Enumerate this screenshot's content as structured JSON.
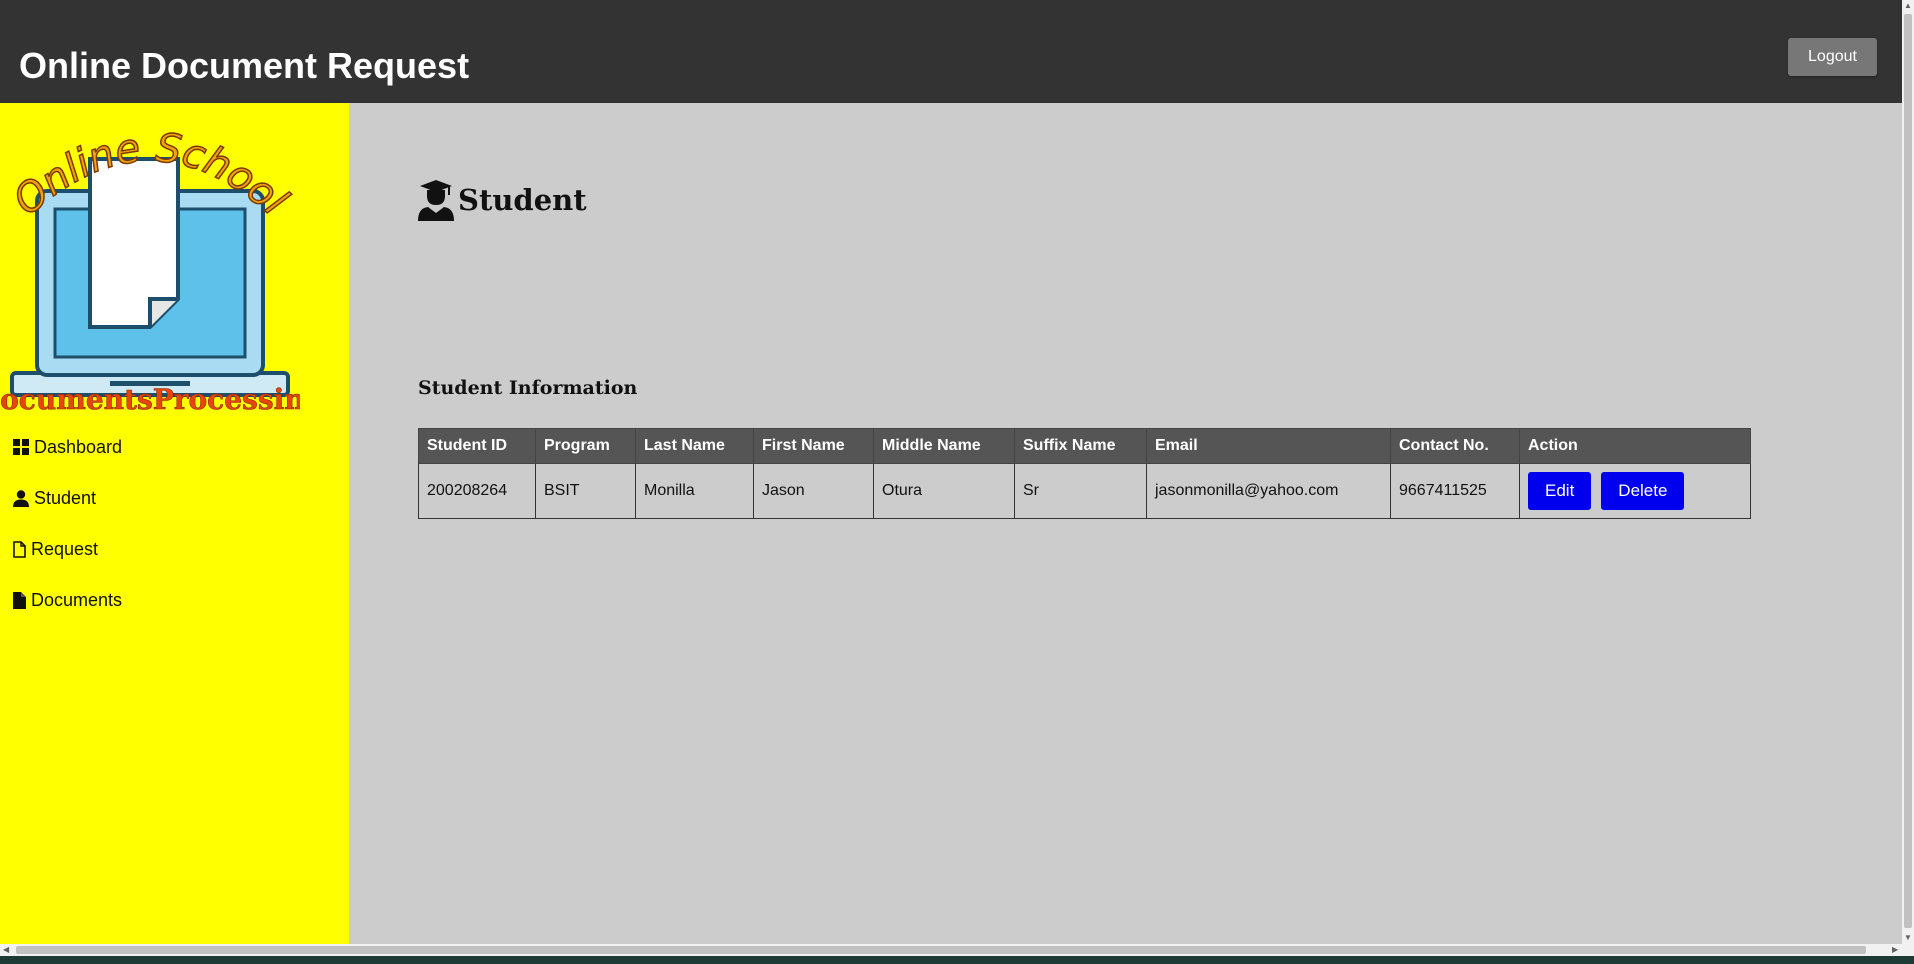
{
  "header": {
    "title": "Online Document Request",
    "logout_label": "Logout"
  },
  "logo": {
    "top_text": "Online School",
    "bottom_text": "DocumentsProcessing"
  },
  "sidebar": {
    "items": [
      {
        "label": "Dashboard",
        "icon": "dashboard-grid-icon"
      },
      {
        "label": "Student",
        "icon": "user-icon"
      },
      {
        "label": "Request",
        "icon": "file-outline-icon"
      },
      {
        "label": "Documents",
        "icon": "file-solid-icon"
      }
    ]
  },
  "main": {
    "page_title": "Student",
    "page_icon": "graduate-icon",
    "section_title": "Student Information",
    "table": {
      "columns": [
        "Student ID",
        "Program",
        "Last Name",
        "First Name",
        "Middle Name",
        "Suffix Name",
        "Email",
        "Contact No.",
        "Action"
      ],
      "rows": [
        {
          "cells": [
            "200208264",
            "BSIT",
            "Monilla",
            "Jason",
            "Otura",
            "Sr",
            "jasonmonilla@yahoo.com",
            "9667411525"
          ],
          "edit_label": "Edit",
          "delete_label": "Delete"
        }
      ]
    }
  },
  "colors": {
    "topbar": "#333333",
    "sidebar": "#ffff00",
    "content": "#cccccc",
    "table_header": "#555555",
    "action_button": "#0000ee",
    "logout_button": "#777777"
  }
}
